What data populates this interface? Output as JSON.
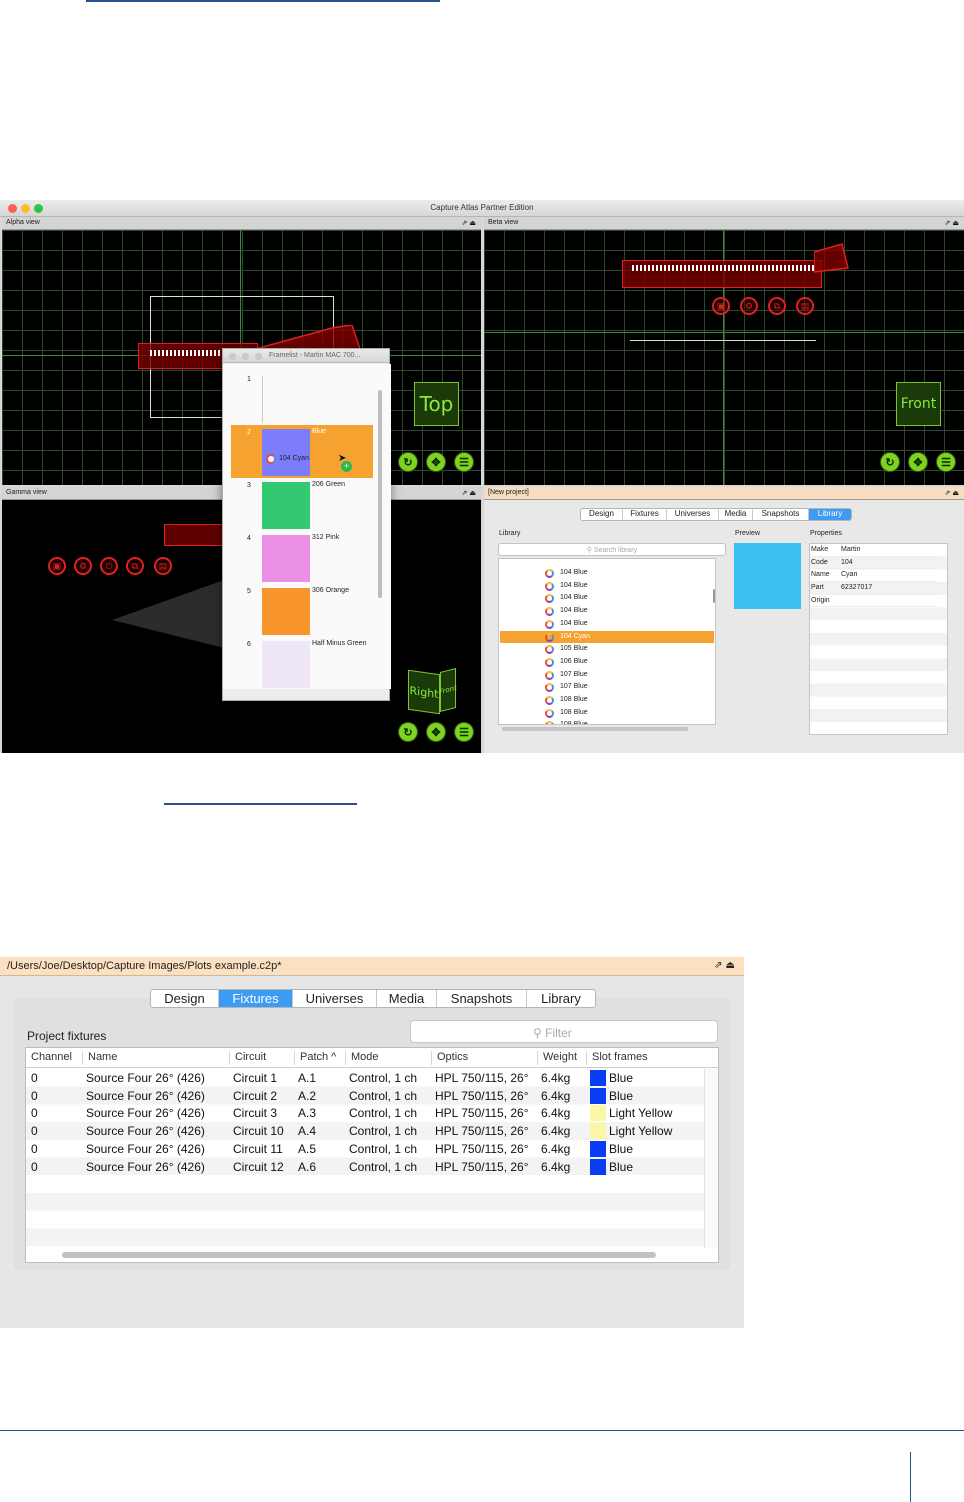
{
  "capture_window": {
    "title": "Capture Atlas Partner Edition",
    "colors": {
      "close": "#fd5f57",
      "minimize": "#fdbc2e",
      "zoom": "#28c840",
      "selection": "#f5a230",
      "accent": "#3d9bf3",
      "fixture_red": "#e02020",
      "nav_green": "#7ed321"
    },
    "alpha_view": {
      "label": "Alpha view",
      "cube_label": "Top"
    },
    "beta_view": {
      "label": "Beta view",
      "cube_label": "Front"
    },
    "gamma_view": {
      "label": "Gamma view",
      "cube_front": "Right",
      "cube_side": "Front"
    },
    "framelist": {
      "title": "Framelist - Martin MAC 700...",
      "drag_label": "104 Cyan",
      "items": [
        {
          "num": "1",
          "name": "",
          "color": "#ececec"
        },
        {
          "num": "2",
          "name": "Blue",
          "color": "#7d7dfb"
        },
        {
          "num": "3",
          "name": "206 Green",
          "color": "#33c971"
        },
        {
          "num": "4",
          "name": "312 Pink",
          "color": "#eb90e4"
        },
        {
          "num": "5",
          "name": "306 Orange",
          "color": "#f7952a"
        },
        {
          "num": "6",
          "name": "Half Minus Green",
          "color": "#efe6f8"
        }
      ]
    },
    "project_pane": {
      "label": "[New project]",
      "tabs": [
        "Design",
        "Fixtures",
        "Universes",
        "Media",
        "Snapshots",
        "Library"
      ],
      "active_tab": "Library",
      "library_label": "Library",
      "search_placeholder": "Search library",
      "library_items": [
        "104 Blue",
        "104 Blue",
        "104 Blue",
        "104 Blue",
        "104 Blue",
        "104 Cyan",
        "105 Blue",
        "106 Blue",
        "107 Blue",
        "107 Blue",
        "108 Blue",
        "108 Blue",
        "108 Blue"
      ],
      "selected_item": "104 Cyan",
      "preview_label": "Preview",
      "preview_color": "#3cbff2",
      "properties_label": "Properties",
      "properties": [
        {
          "key": "Make",
          "value": "Martin"
        },
        {
          "key": "Code",
          "value": "104"
        },
        {
          "key": "Name",
          "value": "Cyan"
        },
        {
          "key": "Part",
          "value": "62327017"
        },
        {
          "key": "Origin",
          "value": ""
        }
      ]
    }
  },
  "project_window": {
    "path": "/Users/Joe/Desktop/Capture Images/Plots example.c2p*",
    "tabs": [
      "Design",
      "Fixtures",
      "Universes",
      "Media",
      "Snapshots",
      "Library"
    ],
    "active_tab": "Fixtures",
    "section_title": "Project fixtures",
    "filter_placeholder": "Filter",
    "columns": [
      "Channel",
      "Name",
      "Circuit",
      "Patch ^",
      "Mode",
      "Optics",
      "Weight",
      "Slot frames"
    ],
    "rows": [
      {
        "channel": "0",
        "name": "Source Four 26° (426)",
        "circuit": "Circuit 1",
        "patch": "A.1",
        "mode": "Control, 1 ch",
        "optics": "HPL 750/115, 26°",
        "weight": "6.4kg",
        "slot": "Blue",
        "slot_color": "#0a3cf5"
      },
      {
        "channel": "0",
        "name": "Source Four 26° (426)",
        "circuit": "Circuit 2",
        "patch": "A.2",
        "mode": "Control, 1 ch",
        "optics": "HPL 750/115, 26°",
        "weight": "6.4kg",
        "slot": "Blue",
        "slot_color": "#0a3cf5"
      },
      {
        "channel": "0",
        "name": "Source Four 26° (426)",
        "circuit": "Circuit 3",
        "patch": "A.3",
        "mode": "Control, 1 ch",
        "optics": "HPL 750/115, 26°",
        "weight": "6.4kg",
        "slot": "Light Yellow",
        "slot_color": "#fbf7a6"
      },
      {
        "channel": "0",
        "name": "Source Four 26° (426)",
        "circuit": "Circuit 10",
        "patch": "A.4",
        "mode": "Control, 1 ch",
        "optics": "HPL 750/115, 26°",
        "weight": "6.4kg",
        "slot": "Light Yellow",
        "slot_color": "#fbf7a6"
      },
      {
        "channel": "0",
        "name": "Source Four 26° (426)",
        "circuit": "Circuit 11",
        "patch": "A.5",
        "mode": "Control, 1 ch",
        "optics": "HPL 750/115, 26°",
        "weight": "6.4kg",
        "slot": "Blue",
        "slot_color": "#0a3cf5"
      },
      {
        "channel": "0",
        "name": "Source Four 26° (426)",
        "circuit": "Circuit 12",
        "patch": "A.6",
        "mode": "Control, 1 ch",
        "optics": "HPL 750/115, 26°",
        "weight": "6.4kg",
        "slot": "Blue",
        "slot_color": "#0a3cf5"
      }
    ]
  }
}
